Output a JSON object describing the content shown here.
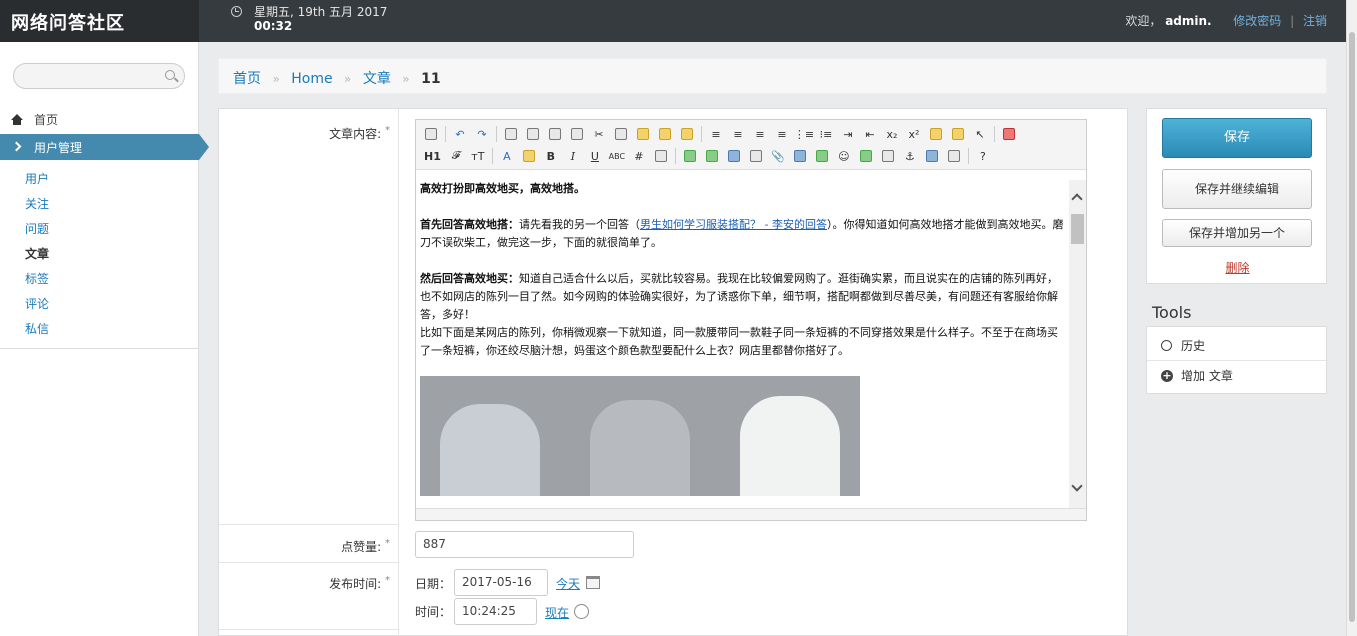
{
  "app": {
    "brand": "网络问答社区"
  },
  "header": {
    "date_line": "星期五, 19th 五月 2017",
    "time_line": "00:32",
    "welcome": "欢迎，",
    "username": "admin.",
    "change_password": "修改密码",
    "separator": "|",
    "logout": "注销"
  },
  "sidebar": {
    "search_placeholder": "",
    "home": "首页",
    "section": "用户管理",
    "items": [
      {
        "label": "用户"
      },
      {
        "label": "关注"
      },
      {
        "label": "问题"
      },
      {
        "label": "文章"
      },
      {
        "label": "标签"
      },
      {
        "label": "评论"
      },
      {
        "label": "私信"
      }
    ],
    "active_item": "文章"
  },
  "breadcrumb": {
    "items": [
      "首页",
      "Home",
      "文章"
    ],
    "current": "11",
    "sep": "»"
  },
  "form": {
    "content_label": "文章内容:",
    "likes_label": "点赞量:",
    "publish_label": "发布时间:",
    "required_mark": "*",
    "likes_value": "887",
    "date_label": "日期：",
    "date_value": "2017-05-16",
    "today_link": "今天",
    "time_label": "时间：",
    "time_value": "10:24:25",
    "now_link": "现在"
  },
  "editor": {
    "toolbar_heading": "H1",
    "content": {
      "p1": "高效打扮即高效地买，高效地搭。",
      "p2_bold": "首先回答高效地搭：",
      "p2_text_a": "请先看我的另一个回答（",
      "p2_link": "男生如何学习服装搭配？ - 李安的回答",
      "p2_text_b": "）。你得知道如何高效地搭才能做到高效地买。磨刀不误砍柴工，做完这一步，下面的就很简单了。",
      "p3_bold": "然后回答高效地买：",
      "p3_text": "知道自己适合什么以后，买就比较容易。我现在比较偏爱网购了。逛街确实累，而且说实在的店铺的陈列再好，也不如网店的陈列一目了然。如今网购的体验确实很好，为了诱惑你下单，细节啊，搭配啊都做到尽善尽美，有问题还有客服给你解答，多好！",
      "p4_text": "比如下面是某网店的陈列，你稍微观察一下就知道，同一款腰带同一款鞋子同一条短裤的不同穿搭效果是什么样子。不至于在商场买了一条短裤，你还绞尽脑汁想，妈蛋这个颜色款型要配什么上衣？网店里都替你搭好了。"
    }
  },
  "actions": {
    "save": "保存",
    "save_continue": "保存并继续编辑",
    "save_add": "保存并增加另一个",
    "delete": "删除"
  },
  "tools": {
    "title": "Tools",
    "history": "历史",
    "add_article": "增加 文章"
  }
}
